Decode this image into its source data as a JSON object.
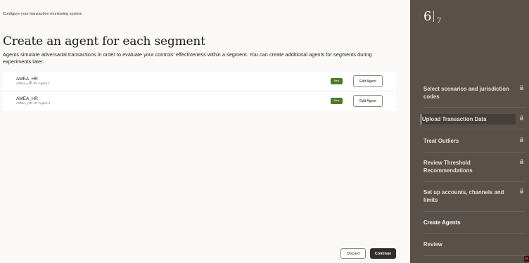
{
  "app_title": "Configure your transaction monitoring system",
  "page": {
    "heading": "Create an agent for each segment",
    "description": "Agents simulate adversarial transactions in order to evaluate your controls' effectiveness within a segment. You can create additional agents for segments during experiments later."
  },
  "agents": [
    {
      "name": "AMEA_HR",
      "subtitle": "AMEA_HR RL Agent 1",
      "badge": "New",
      "edit_label": "Edit Agent"
    },
    {
      "name": "AMEA_HR",
      "subtitle": "AMEA_HR HT Agent 1",
      "badge": "New",
      "edit_label": "Edit Agent"
    }
  ],
  "footer": {
    "discard_label": "Discard",
    "continue_label": "Continue"
  },
  "sidebar": {
    "step_current": "6",
    "step_total": "7",
    "steps": [
      {
        "label": "Select scenarios and jurisdiction codes",
        "locked": true
      },
      {
        "label": "Upload Transaction Data",
        "locked": true,
        "highlighted": true
      },
      {
        "label": "Treat Outliers",
        "locked": true
      },
      {
        "label": "Review Threshold Recommendations",
        "locked": true
      },
      {
        "label": "Set up accounts, channels and limits",
        "locked": true
      },
      {
        "label": "Create Agents",
        "locked": false,
        "active": true
      },
      {
        "label": "Review",
        "locked": false
      }
    ]
  },
  "colors": {
    "sidebar_bg": "#585049",
    "badge_green": "#4f7a28",
    "primary_button": "#312d2a"
  }
}
